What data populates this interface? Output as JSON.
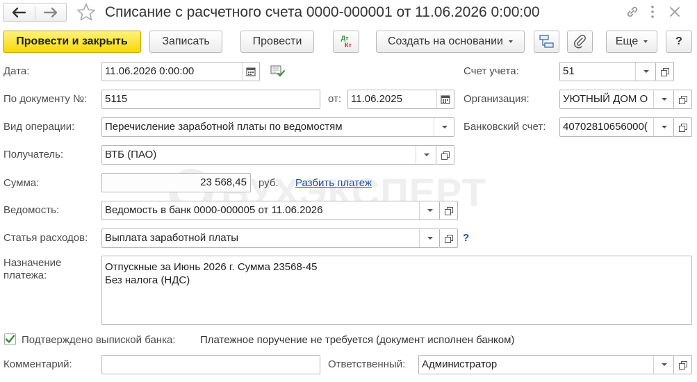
{
  "window": {
    "title": "Списание с расчетного счета 0000-000001 от 11.06.2026 0:00:00"
  },
  "toolbar": {
    "post_close_label": "Провести и закрыть",
    "save_label": "Записать",
    "post_label": "Провести",
    "dtkt_top": "Дт",
    "dtkt_bottom": "Кт",
    "create_based_label": "Создать на основании",
    "more_label": "Еще",
    "help_label": "?"
  },
  "form": {
    "date": {
      "label": "Дата:",
      "value": "11.06.2026  0:00:00"
    },
    "doc_number": {
      "label": "По документу №:",
      "value": "5115"
    },
    "doc_date": {
      "label": "от:",
      "value": "11.06.2025"
    },
    "operation_type": {
      "label": "Вид операции:",
      "value": "Перечисление заработной платы по ведомостям"
    },
    "recipient": {
      "label": "Получатель:",
      "value": "ВТБ (ПАО)"
    },
    "amount": {
      "label": "Сумма:",
      "value": "23 568,45",
      "currency": "руб.",
      "split_link": "Разбить платеж"
    },
    "statement": {
      "label": "Ведомость:",
      "value": "Ведомость в банк 0000-000005 от 11.06.2026"
    },
    "expense_item": {
      "label": "Статья расходов:",
      "value": "Выплата заработной платы",
      "help": "?"
    },
    "purpose": {
      "label_line1": "Назначение",
      "label_line2": "платежа:",
      "line1": "Отпускные за Июнь 2026 г. Сумма 23568-45",
      "line2": "Без налога (НДС)"
    },
    "account": {
      "label": "Счет учета:",
      "value": "51"
    },
    "organization": {
      "label": "Организация:",
      "value": "УЮТНЫЙ ДОМ О"
    },
    "bank_account": {
      "label": "Банковский счет:",
      "value": "40702810656000("
    },
    "confirmed": {
      "label": "Подтверждено выпиской банка:",
      "checked": true
    },
    "payment_order_note": "Платежное поручение не требуется (документ исполнен банком)",
    "comment": {
      "label": "Комментарий:",
      "value": ""
    },
    "responsible": {
      "label": "Ответственный:",
      "value": "Администратор"
    }
  },
  "watermark": "БУХЭКСПЕРТ",
  "colors": {
    "primary_button": "#f5d90a",
    "link": "#1b4fa8",
    "checkbox": "#2e8b2e",
    "watermark": "#eeeeee"
  }
}
